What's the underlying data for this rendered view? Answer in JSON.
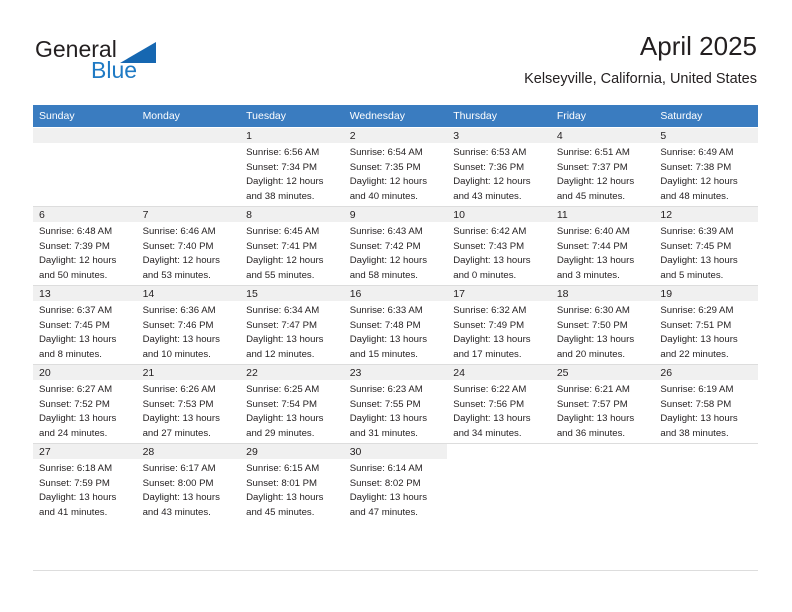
{
  "brand": {
    "name_primary": "General",
    "name_secondary": "Blue",
    "triangle_color": "#1667b1",
    "secondary_color": "#1f7ac4"
  },
  "header": {
    "title": "April 2025",
    "location": "Kelseyville, California, United States"
  },
  "theme": {
    "header_row_bg": "#3a7cc0",
    "day_number_bg": "#f0f0f0",
    "text_color": "#231f20",
    "grid_line": "#dddddd"
  },
  "weekday_headers": [
    "Sunday",
    "Monday",
    "Tuesday",
    "Wednesday",
    "Thursday",
    "Friday",
    "Saturday"
  ],
  "labels": {
    "sunrise_prefix": "Sunrise:",
    "sunset_prefix": "Sunset:",
    "daylight_prefix": "Daylight:"
  },
  "weeks": [
    [
      {
        "day": "",
        "line1": "",
        "line2": "",
        "line3": "",
        "line4": "",
        "empty": true
      },
      {
        "day": "",
        "line1": "",
        "line2": "",
        "line3": "",
        "line4": "",
        "empty": true
      },
      {
        "day": "1",
        "line1": "Sunrise: 6:56 AM",
        "line2": "Sunset: 7:34 PM",
        "line3": "Daylight: 12 hours",
        "line4": "and 38 minutes."
      },
      {
        "day": "2",
        "line1": "Sunrise: 6:54 AM",
        "line2": "Sunset: 7:35 PM",
        "line3": "Daylight: 12 hours",
        "line4": "and 40 minutes."
      },
      {
        "day": "3",
        "line1": "Sunrise: 6:53 AM",
        "line2": "Sunset: 7:36 PM",
        "line3": "Daylight: 12 hours",
        "line4": "and 43 minutes."
      },
      {
        "day": "4",
        "line1": "Sunrise: 6:51 AM",
        "line2": "Sunset: 7:37 PM",
        "line3": "Daylight: 12 hours",
        "line4": "and 45 minutes."
      },
      {
        "day": "5",
        "line1": "Sunrise: 6:49 AM",
        "line2": "Sunset: 7:38 PM",
        "line3": "Daylight: 12 hours",
        "line4": "and 48 minutes."
      }
    ],
    [
      {
        "day": "6",
        "line1": "Sunrise: 6:48 AM",
        "line2": "Sunset: 7:39 PM",
        "line3": "Daylight: 12 hours",
        "line4": "and 50 minutes."
      },
      {
        "day": "7",
        "line1": "Sunrise: 6:46 AM",
        "line2": "Sunset: 7:40 PM",
        "line3": "Daylight: 12 hours",
        "line4": "and 53 minutes."
      },
      {
        "day": "8",
        "line1": "Sunrise: 6:45 AM",
        "line2": "Sunset: 7:41 PM",
        "line3": "Daylight: 12 hours",
        "line4": "and 55 minutes."
      },
      {
        "day": "9",
        "line1": "Sunrise: 6:43 AM",
        "line2": "Sunset: 7:42 PM",
        "line3": "Daylight: 12 hours",
        "line4": "and 58 minutes."
      },
      {
        "day": "10",
        "line1": "Sunrise: 6:42 AM",
        "line2": "Sunset: 7:43 PM",
        "line3": "Daylight: 13 hours",
        "line4": "and 0 minutes."
      },
      {
        "day": "11",
        "line1": "Sunrise: 6:40 AM",
        "line2": "Sunset: 7:44 PM",
        "line3": "Daylight: 13 hours",
        "line4": "and 3 minutes."
      },
      {
        "day": "12",
        "line1": "Sunrise: 6:39 AM",
        "line2": "Sunset: 7:45 PM",
        "line3": "Daylight: 13 hours",
        "line4": "and 5 minutes."
      }
    ],
    [
      {
        "day": "13",
        "line1": "Sunrise: 6:37 AM",
        "line2": "Sunset: 7:45 PM",
        "line3": "Daylight: 13 hours",
        "line4": "and 8 minutes."
      },
      {
        "day": "14",
        "line1": "Sunrise: 6:36 AM",
        "line2": "Sunset: 7:46 PM",
        "line3": "Daylight: 13 hours",
        "line4": "and 10 minutes."
      },
      {
        "day": "15",
        "line1": "Sunrise: 6:34 AM",
        "line2": "Sunset: 7:47 PM",
        "line3": "Daylight: 13 hours",
        "line4": "and 12 minutes."
      },
      {
        "day": "16",
        "line1": "Sunrise: 6:33 AM",
        "line2": "Sunset: 7:48 PM",
        "line3": "Daylight: 13 hours",
        "line4": "and 15 minutes."
      },
      {
        "day": "17",
        "line1": "Sunrise: 6:32 AM",
        "line2": "Sunset: 7:49 PM",
        "line3": "Daylight: 13 hours",
        "line4": "and 17 minutes."
      },
      {
        "day": "18",
        "line1": "Sunrise: 6:30 AM",
        "line2": "Sunset: 7:50 PM",
        "line3": "Daylight: 13 hours",
        "line4": "and 20 minutes."
      },
      {
        "day": "19",
        "line1": "Sunrise: 6:29 AM",
        "line2": "Sunset: 7:51 PM",
        "line3": "Daylight: 13 hours",
        "line4": "and 22 minutes."
      }
    ],
    [
      {
        "day": "20",
        "line1": "Sunrise: 6:27 AM",
        "line2": "Sunset: 7:52 PM",
        "line3": "Daylight: 13 hours",
        "line4": "and 24 minutes."
      },
      {
        "day": "21",
        "line1": "Sunrise: 6:26 AM",
        "line2": "Sunset: 7:53 PM",
        "line3": "Daylight: 13 hours",
        "line4": "and 27 minutes."
      },
      {
        "day": "22",
        "line1": "Sunrise: 6:25 AM",
        "line2": "Sunset: 7:54 PM",
        "line3": "Daylight: 13 hours",
        "line4": "and 29 minutes."
      },
      {
        "day": "23",
        "line1": "Sunrise: 6:23 AM",
        "line2": "Sunset: 7:55 PM",
        "line3": "Daylight: 13 hours",
        "line4": "and 31 minutes."
      },
      {
        "day": "24",
        "line1": "Sunrise: 6:22 AM",
        "line2": "Sunset: 7:56 PM",
        "line3": "Daylight: 13 hours",
        "line4": "and 34 minutes."
      },
      {
        "day": "25",
        "line1": "Sunrise: 6:21 AM",
        "line2": "Sunset: 7:57 PM",
        "line3": "Daylight: 13 hours",
        "line4": "and 36 minutes."
      },
      {
        "day": "26",
        "line1": "Sunrise: 6:19 AM",
        "line2": "Sunset: 7:58 PM",
        "line3": "Daylight: 13 hours",
        "line4": "and 38 minutes."
      }
    ],
    [
      {
        "day": "27",
        "line1": "Sunrise: 6:18 AM",
        "line2": "Sunset: 7:59 PM",
        "line3": "Daylight: 13 hours",
        "line4": "and 41 minutes."
      },
      {
        "day": "28",
        "line1": "Sunrise: 6:17 AM",
        "line2": "Sunset: 8:00 PM",
        "line3": "Daylight: 13 hours",
        "line4": "and 43 minutes."
      },
      {
        "day": "29",
        "line1": "Sunrise: 6:15 AM",
        "line2": "Sunset: 8:01 PM",
        "line3": "Daylight: 13 hours",
        "line4": "and 45 minutes."
      },
      {
        "day": "30",
        "line1": "Sunrise: 6:14 AM",
        "line2": "Sunset: 8:02 PM",
        "line3": "Daylight: 13 hours",
        "line4": "and 47 minutes."
      },
      {
        "day": "",
        "line1": "",
        "line2": "",
        "line3": "",
        "line4": "",
        "empty": true,
        "nofill": true
      },
      {
        "day": "",
        "line1": "",
        "line2": "",
        "line3": "",
        "line4": "",
        "empty": true,
        "nofill": true
      },
      {
        "day": "",
        "line1": "",
        "line2": "",
        "line3": "",
        "line4": "",
        "empty": true,
        "nofill": true
      }
    ]
  ]
}
